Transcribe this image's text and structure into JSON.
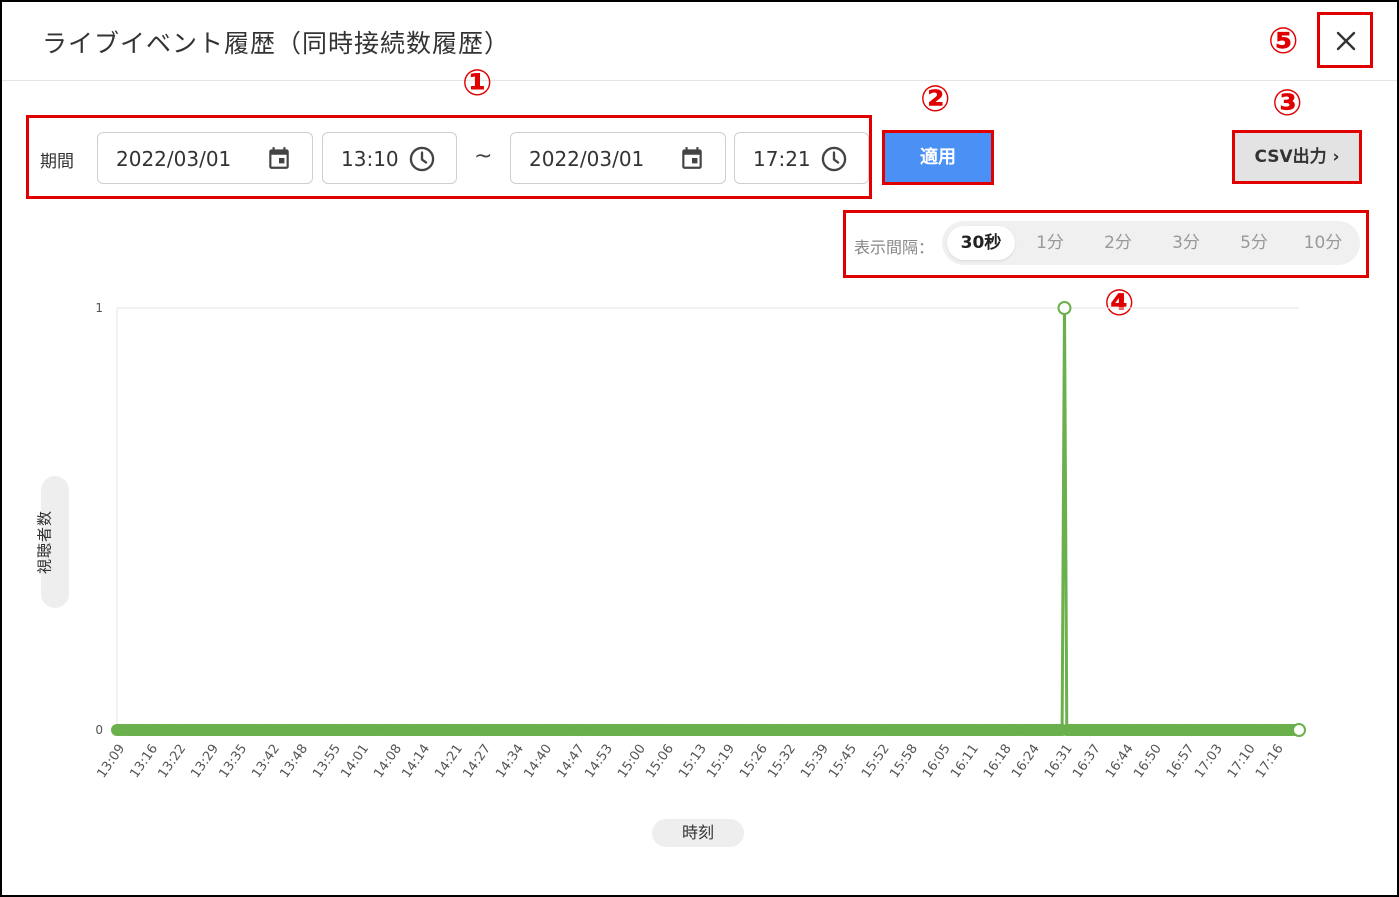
{
  "header": {
    "title": "ライブイベント履歴（同時接続数履歴）",
    "close_glyph": "✕"
  },
  "annotations": [
    "①",
    "②",
    "③",
    "④",
    "⑤"
  ],
  "filter": {
    "period_label": "期間",
    "start_date": "2022/03/01",
    "start_time": "13:10",
    "separator": "~",
    "end_date": "2022/03/01",
    "end_time": "17:21",
    "apply_label": "適用",
    "csv_label": "CSV出力 ›"
  },
  "interval": {
    "label": "表示間隔：",
    "options": [
      "30秒",
      "1分",
      "2分",
      "3分",
      "5分",
      "10分"
    ],
    "selected": "30秒"
  },
  "icons": {
    "calendar": "calendar-icon",
    "clock": "clock-icon",
    "close": "close-icon"
  },
  "colors": {
    "apply_button": "#4a90f5",
    "series": "#6ab04c",
    "annotation": "#e10000"
  },
  "chart_data": {
    "type": "line",
    "xlabel": "時刻",
    "ylabel": "視聴者数",
    "ylim": [
      0,
      1
    ],
    "yticks": [
      "0",
      "1"
    ],
    "x_ticks": [
      "13:09",
      "13:16",
      "13:22",
      "13:29",
      "13:35",
      "13:42",
      "13:48",
      "13:55",
      "14:01",
      "14:08",
      "14:14",
      "14:21",
      "14:27",
      "14:34",
      "14:40",
      "14:47",
      "14:53",
      "15:00",
      "15:06",
      "15:13",
      "15:19",
      "15:26",
      "15:32",
      "15:39",
      "15:45",
      "15:52",
      "15:58",
      "16:05",
      "16:11",
      "16:18",
      "16:24",
      "16:31",
      "16:37",
      "16:44",
      "16:50",
      "16:57",
      "17:03",
      "17:10",
      "17:16"
    ],
    "x_start": "13:09",
    "x_end": "17:21",
    "interval": "30秒",
    "series": [
      {
        "points": [
          {
            "x": "16:30:30",
            "y": 0
          },
          {
            "x": "16:31:00",
            "y": 1
          },
          {
            "x": "16:31:30",
            "y": 0
          }
        ],
        "baseline": 0
      }
    ],
    "grid": true
  }
}
